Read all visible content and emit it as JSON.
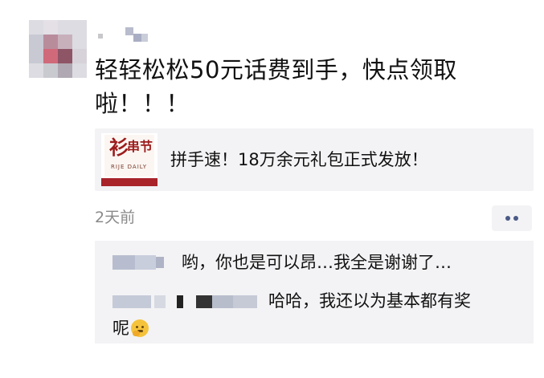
{
  "post": {
    "text_line1": "轻轻松松50元话费到手，快点领取",
    "text_line2": "啦！！！",
    "link": {
      "thumb_glyph": "衫",
      "thumb_word": "串节",
      "thumb_sub": "RIJE  DAILY",
      "title": "拼手速！18万余元礼包正式发放！"
    },
    "timestamp": "2天前"
  },
  "comments": [
    {
      "text": "哟，你也是可以昂…我全是谢谢了…"
    },
    {
      "text_line1": "哈哈，我还以为基本都有奖",
      "text_line2": "呢"
    }
  ],
  "icons": {
    "more": "more-dots-icon",
    "emoji": "face-hand-over-mouth-icon"
  },
  "colors": {
    "more_dots": "#4a5a86",
    "card_bg": "#f3f3f5",
    "timestamp": "#8a8a8a"
  }
}
